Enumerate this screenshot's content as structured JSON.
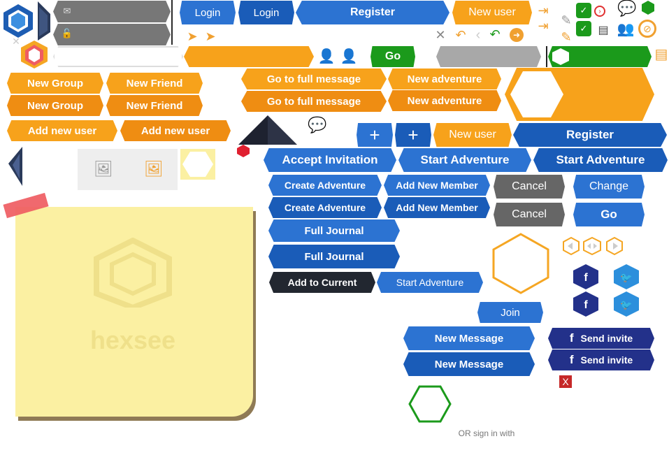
{
  "login": {
    "primary": "Login",
    "secondary": "Login"
  },
  "register": {
    "top": "Register",
    "mid": "Register"
  },
  "new_user": {
    "top": "New user",
    "mid": "New user"
  },
  "go": {
    "green": "Go",
    "blue": "Go"
  },
  "new_group": [
    "New Group",
    "New Group"
  ],
  "new_friend": [
    "New Friend",
    "New Friend"
  ],
  "add_new_user": [
    "Add new user",
    "Add new user"
  ],
  "go_to_full_message": [
    "Go to full message",
    "Go to full message"
  ],
  "new_adventure": [
    "New adventure",
    "New adventure"
  ],
  "accept_invitation": "Accept Invitation",
  "start_adventure": [
    "Start Adventure",
    "Start Adventure",
    "Start Adventure"
  ],
  "create_adventure": [
    "Create Adventure",
    "Create Adventure"
  ],
  "add_new_member": [
    "Add New Member",
    "Add New Member"
  ],
  "cancel": [
    "Cancel",
    "Cancel"
  ],
  "change": "Change",
  "full_journal": [
    "Full Journal",
    "Full Journal"
  ],
  "add_to_current": "Add to Current",
  "join": "Join",
  "new_message": [
    "New Message",
    "New Message"
  ],
  "send_invite": [
    "Send invite",
    "Send invite"
  ],
  "or_sign_in": "OR sign in with",
  "logo_text": "hexsee",
  "x_mark": "X",
  "colors": {
    "orange": "#f7a21b",
    "blue": "#2c73d2",
    "navy": "#23318a",
    "green": "#1b9a1b",
    "sticky": "#fbf0a2"
  },
  "icons": [
    "envelope-icon",
    "lock-icon",
    "close-icon",
    "send-icon",
    "reply-icon",
    "reply-all-icon",
    "chevron-left-icon",
    "arrow-right-icon",
    "export-icon",
    "edit-icon",
    "checkbox-icon",
    "chat-icon",
    "group-icon",
    "compass-icon",
    "document-icon",
    "add-user-icon",
    "user-check-icon",
    "plus-icon",
    "image-add-icon",
    "facebook-icon",
    "twitter-icon"
  ]
}
